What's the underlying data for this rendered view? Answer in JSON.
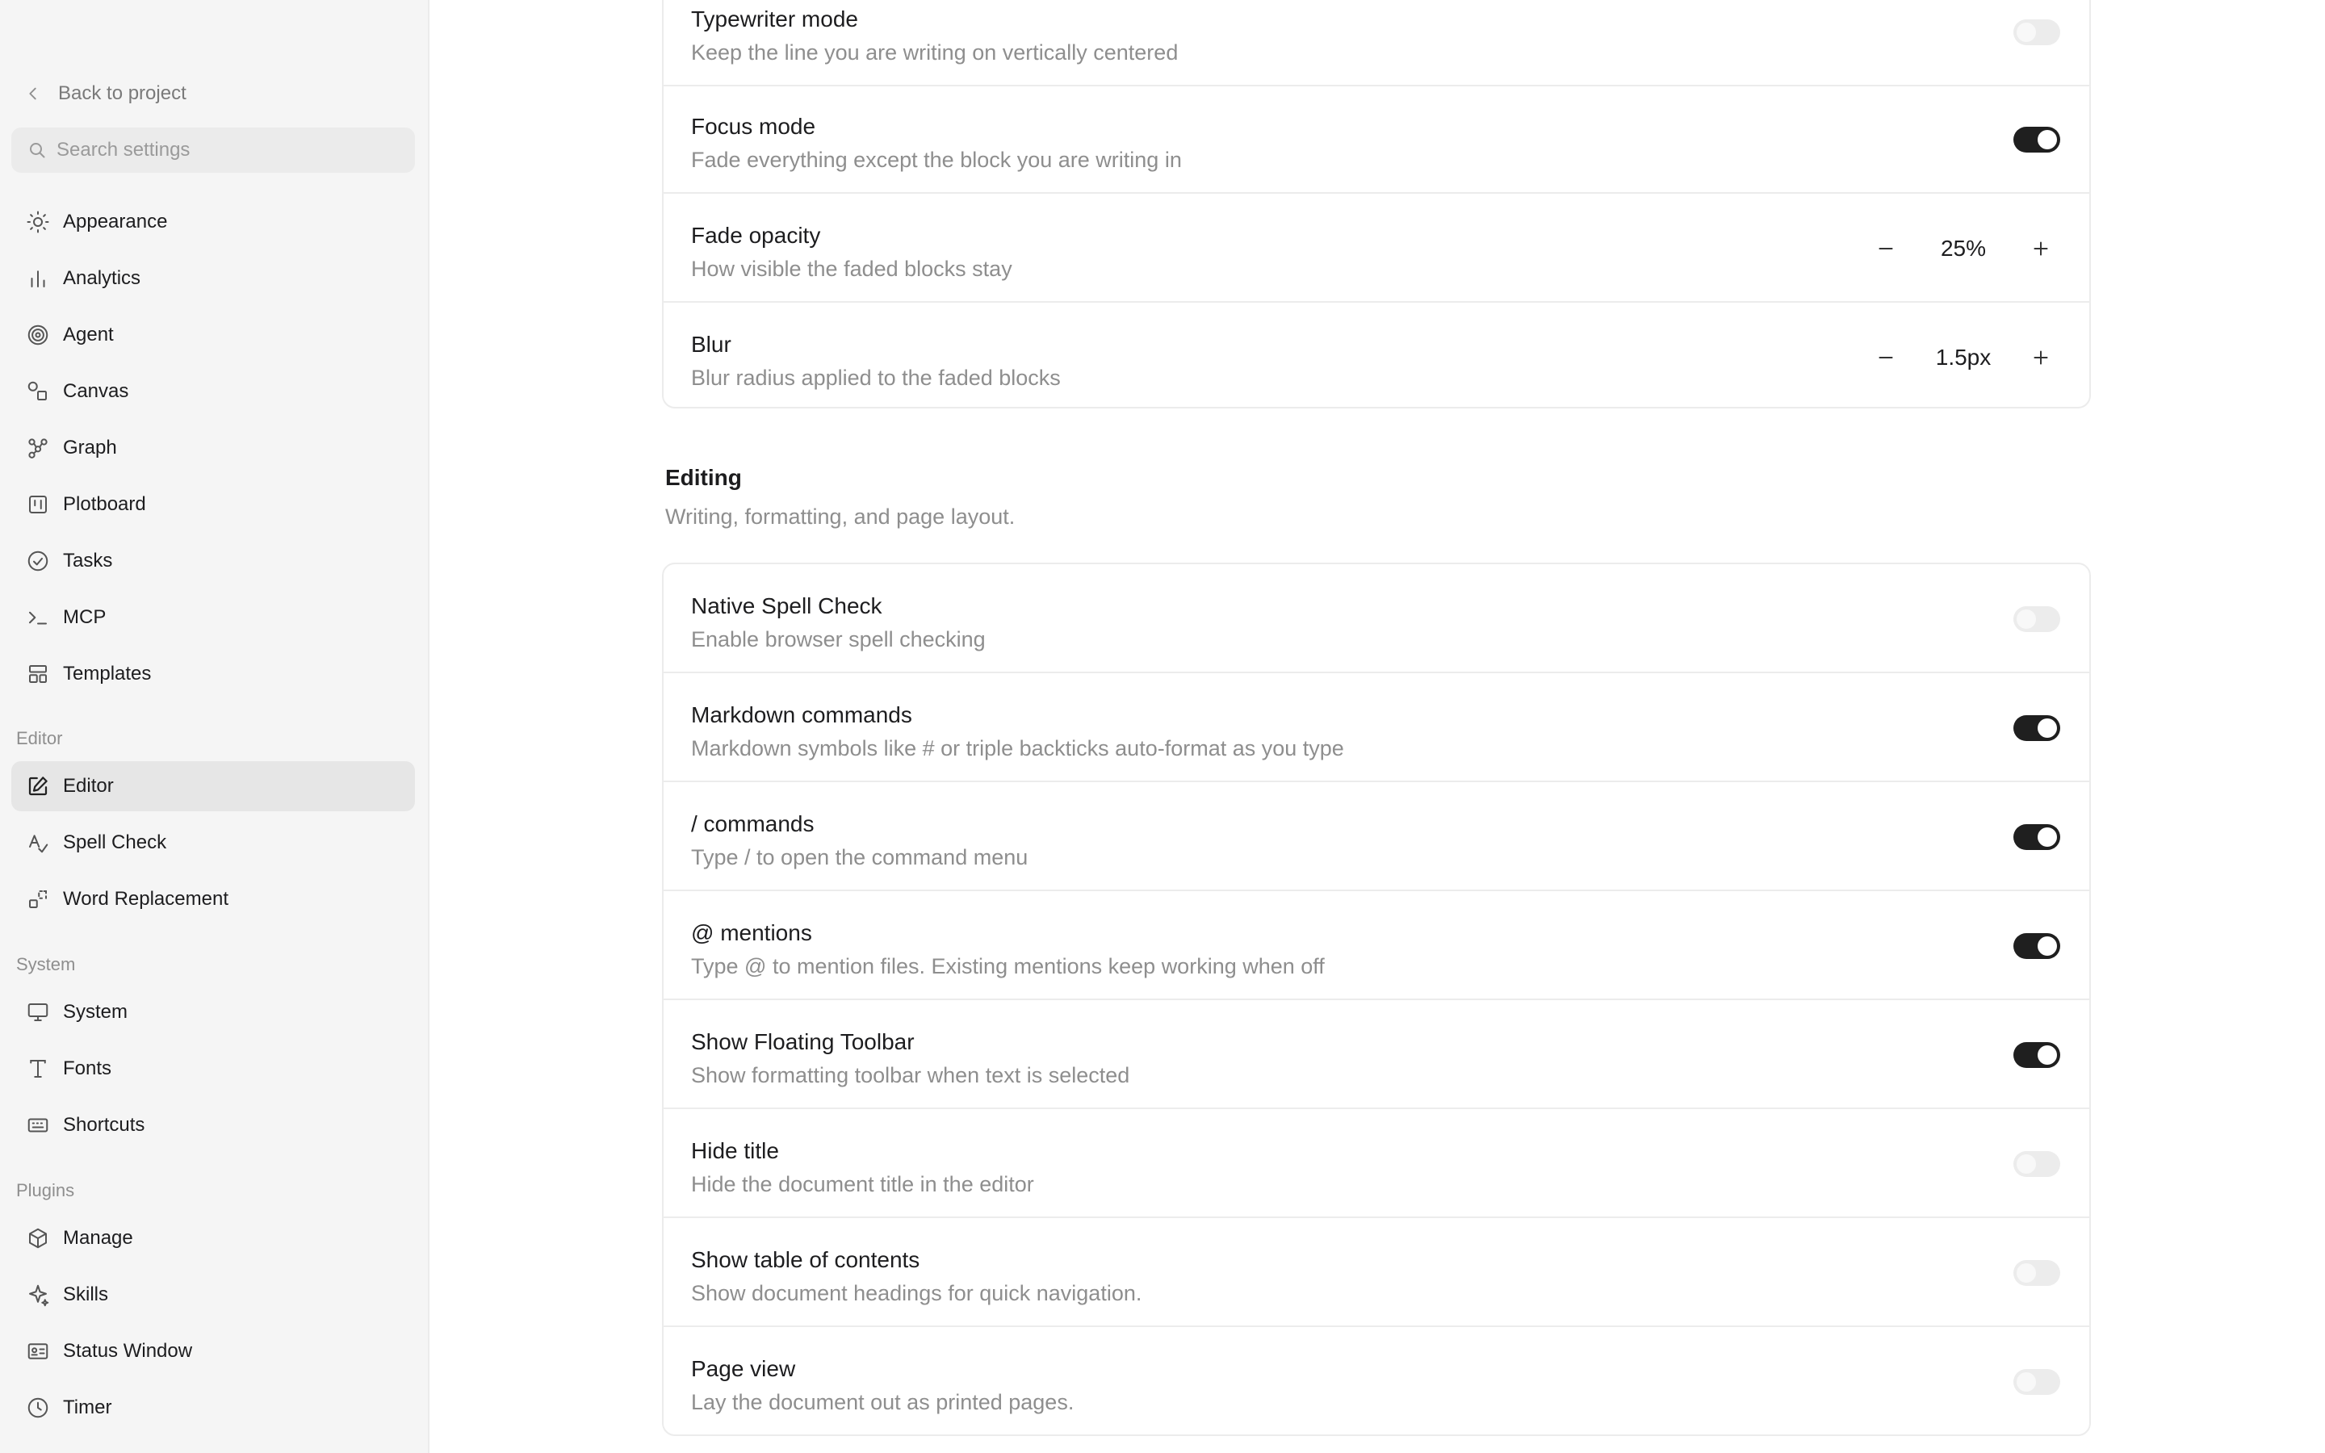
{
  "sidebar": {
    "back_label": "Back to project",
    "search_placeholder": "Search settings",
    "items": [
      {
        "label": "Appearance",
        "icon": "sun-icon"
      },
      {
        "label": "Analytics",
        "icon": "bar-chart-icon"
      },
      {
        "label": "Agent",
        "icon": "spiral-icon"
      },
      {
        "label": "Canvas",
        "icon": "shapes-icon"
      },
      {
        "label": "Graph",
        "icon": "graph-nodes-icon"
      },
      {
        "label": "Plotboard",
        "icon": "board-icon"
      },
      {
        "label": "Tasks",
        "icon": "check-circle-icon"
      },
      {
        "label": "MCP",
        "icon": "terminal-icon"
      },
      {
        "label": "Templates",
        "icon": "layout-icon"
      }
    ],
    "groups": {
      "editor": {
        "label": "Editor",
        "items": [
          {
            "label": "Editor",
            "icon": "edit-icon",
            "active": true
          },
          {
            "label": "Spell Check",
            "icon": "spell-check-icon"
          },
          {
            "label": "Word Replacement",
            "icon": "replace-icon"
          }
        ]
      },
      "system": {
        "label": "System",
        "items": [
          {
            "label": "System",
            "icon": "monitor-icon"
          },
          {
            "label": "Fonts",
            "icon": "type-icon"
          },
          {
            "label": "Shortcuts",
            "icon": "keyboard-icon"
          }
        ]
      },
      "plugins": {
        "label": "Plugins",
        "items": [
          {
            "label": "Manage",
            "icon": "package-icon"
          },
          {
            "label": "Skills",
            "icon": "sparkle-icon"
          },
          {
            "label": "Status Window",
            "icon": "id-card-icon"
          },
          {
            "label": "Timer",
            "icon": "clock-icon"
          }
        ]
      }
    }
  },
  "focus_card": {
    "rows": [
      {
        "title": "Typewriter mode",
        "desc": "Keep the line you are writing on vertically centered",
        "toggle": false
      },
      {
        "title": "Focus mode",
        "desc": "Fade everything except the block you are writing in",
        "toggle": true
      },
      {
        "title": "Fade opacity",
        "desc": "How visible the faded blocks stay",
        "value": "25%"
      },
      {
        "title": "Blur",
        "desc": "Blur radius applied to the faded blocks",
        "value": "1.5px"
      }
    ]
  },
  "editing": {
    "title": "Editing",
    "desc": "Writing, formatting, and page layout.",
    "rows": [
      {
        "title": "Native Spell Check",
        "desc": "Enable browser spell checking",
        "toggle": false
      },
      {
        "title": "Markdown commands",
        "desc": "Markdown symbols like # or triple backticks auto-format as you type",
        "toggle": true
      },
      {
        "title": "/ commands",
        "desc": "Type / to open the command menu",
        "toggle": true
      },
      {
        "title": "@ mentions",
        "desc": "Type @ to mention files. Existing mentions keep working when off",
        "toggle": true
      },
      {
        "title": "Show Floating Toolbar",
        "desc": "Show formatting toolbar when text is selected",
        "toggle": true
      },
      {
        "title": "Hide title",
        "desc": "Hide the document title in the editor",
        "toggle": false
      },
      {
        "title": "Show table of contents",
        "desc": "Show document headings for quick navigation.",
        "toggle": false
      },
      {
        "title": "Page view",
        "desc": "Lay the document out as printed pages.",
        "toggle": false
      }
    ]
  }
}
